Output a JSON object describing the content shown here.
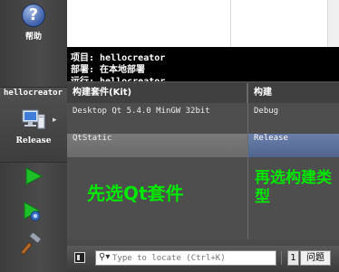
{
  "sidebar": {
    "help_label": "帮助",
    "help_glyph": "?",
    "target": {
      "project": "hellocreator",
      "config": "Release",
      "arrow": "▸"
    }
  },
  "info": {
    "project_row": "项目: hellocreator",
    "deploy_row": "部署: 在本地部署",
    "run_row": "运行: hellocreator"
  },
  "kit_table": {
    "headers": {
      "kit": "构建套件(Kit)",
      "build": "构建"
    },
    "rows": [
      {
        "kit": "Desktop Qt 5.4.0 MinGW 32bit",
        "build": "Debug",
        "selected": false
      },
      {
        "kit": "QtStatic",
        "build": "Release",
        "selected": true
      }
    ],
    "annotation_kit": "先选Qt套件",
    "annotation_build": "再选构建类型"
  },
  "statusbar": {
    "locator_placeholder": "Type to locate (Ctrl+K)",
    "issues_number": "1",
    "issues_label": "问题"
  },
  "colors": {
    "annotation": "#00e600",
    "selected_kit": "#707070",
    "selected_build": "#5a6f9a"
  },
  "icons": [
    "help-icon",
    "computer-icon",
    "run-icon",
    "debug-run-icon",
    "hammer-icon",
    "search-icon",
    "panel-toggle-icon"
  ]
}
